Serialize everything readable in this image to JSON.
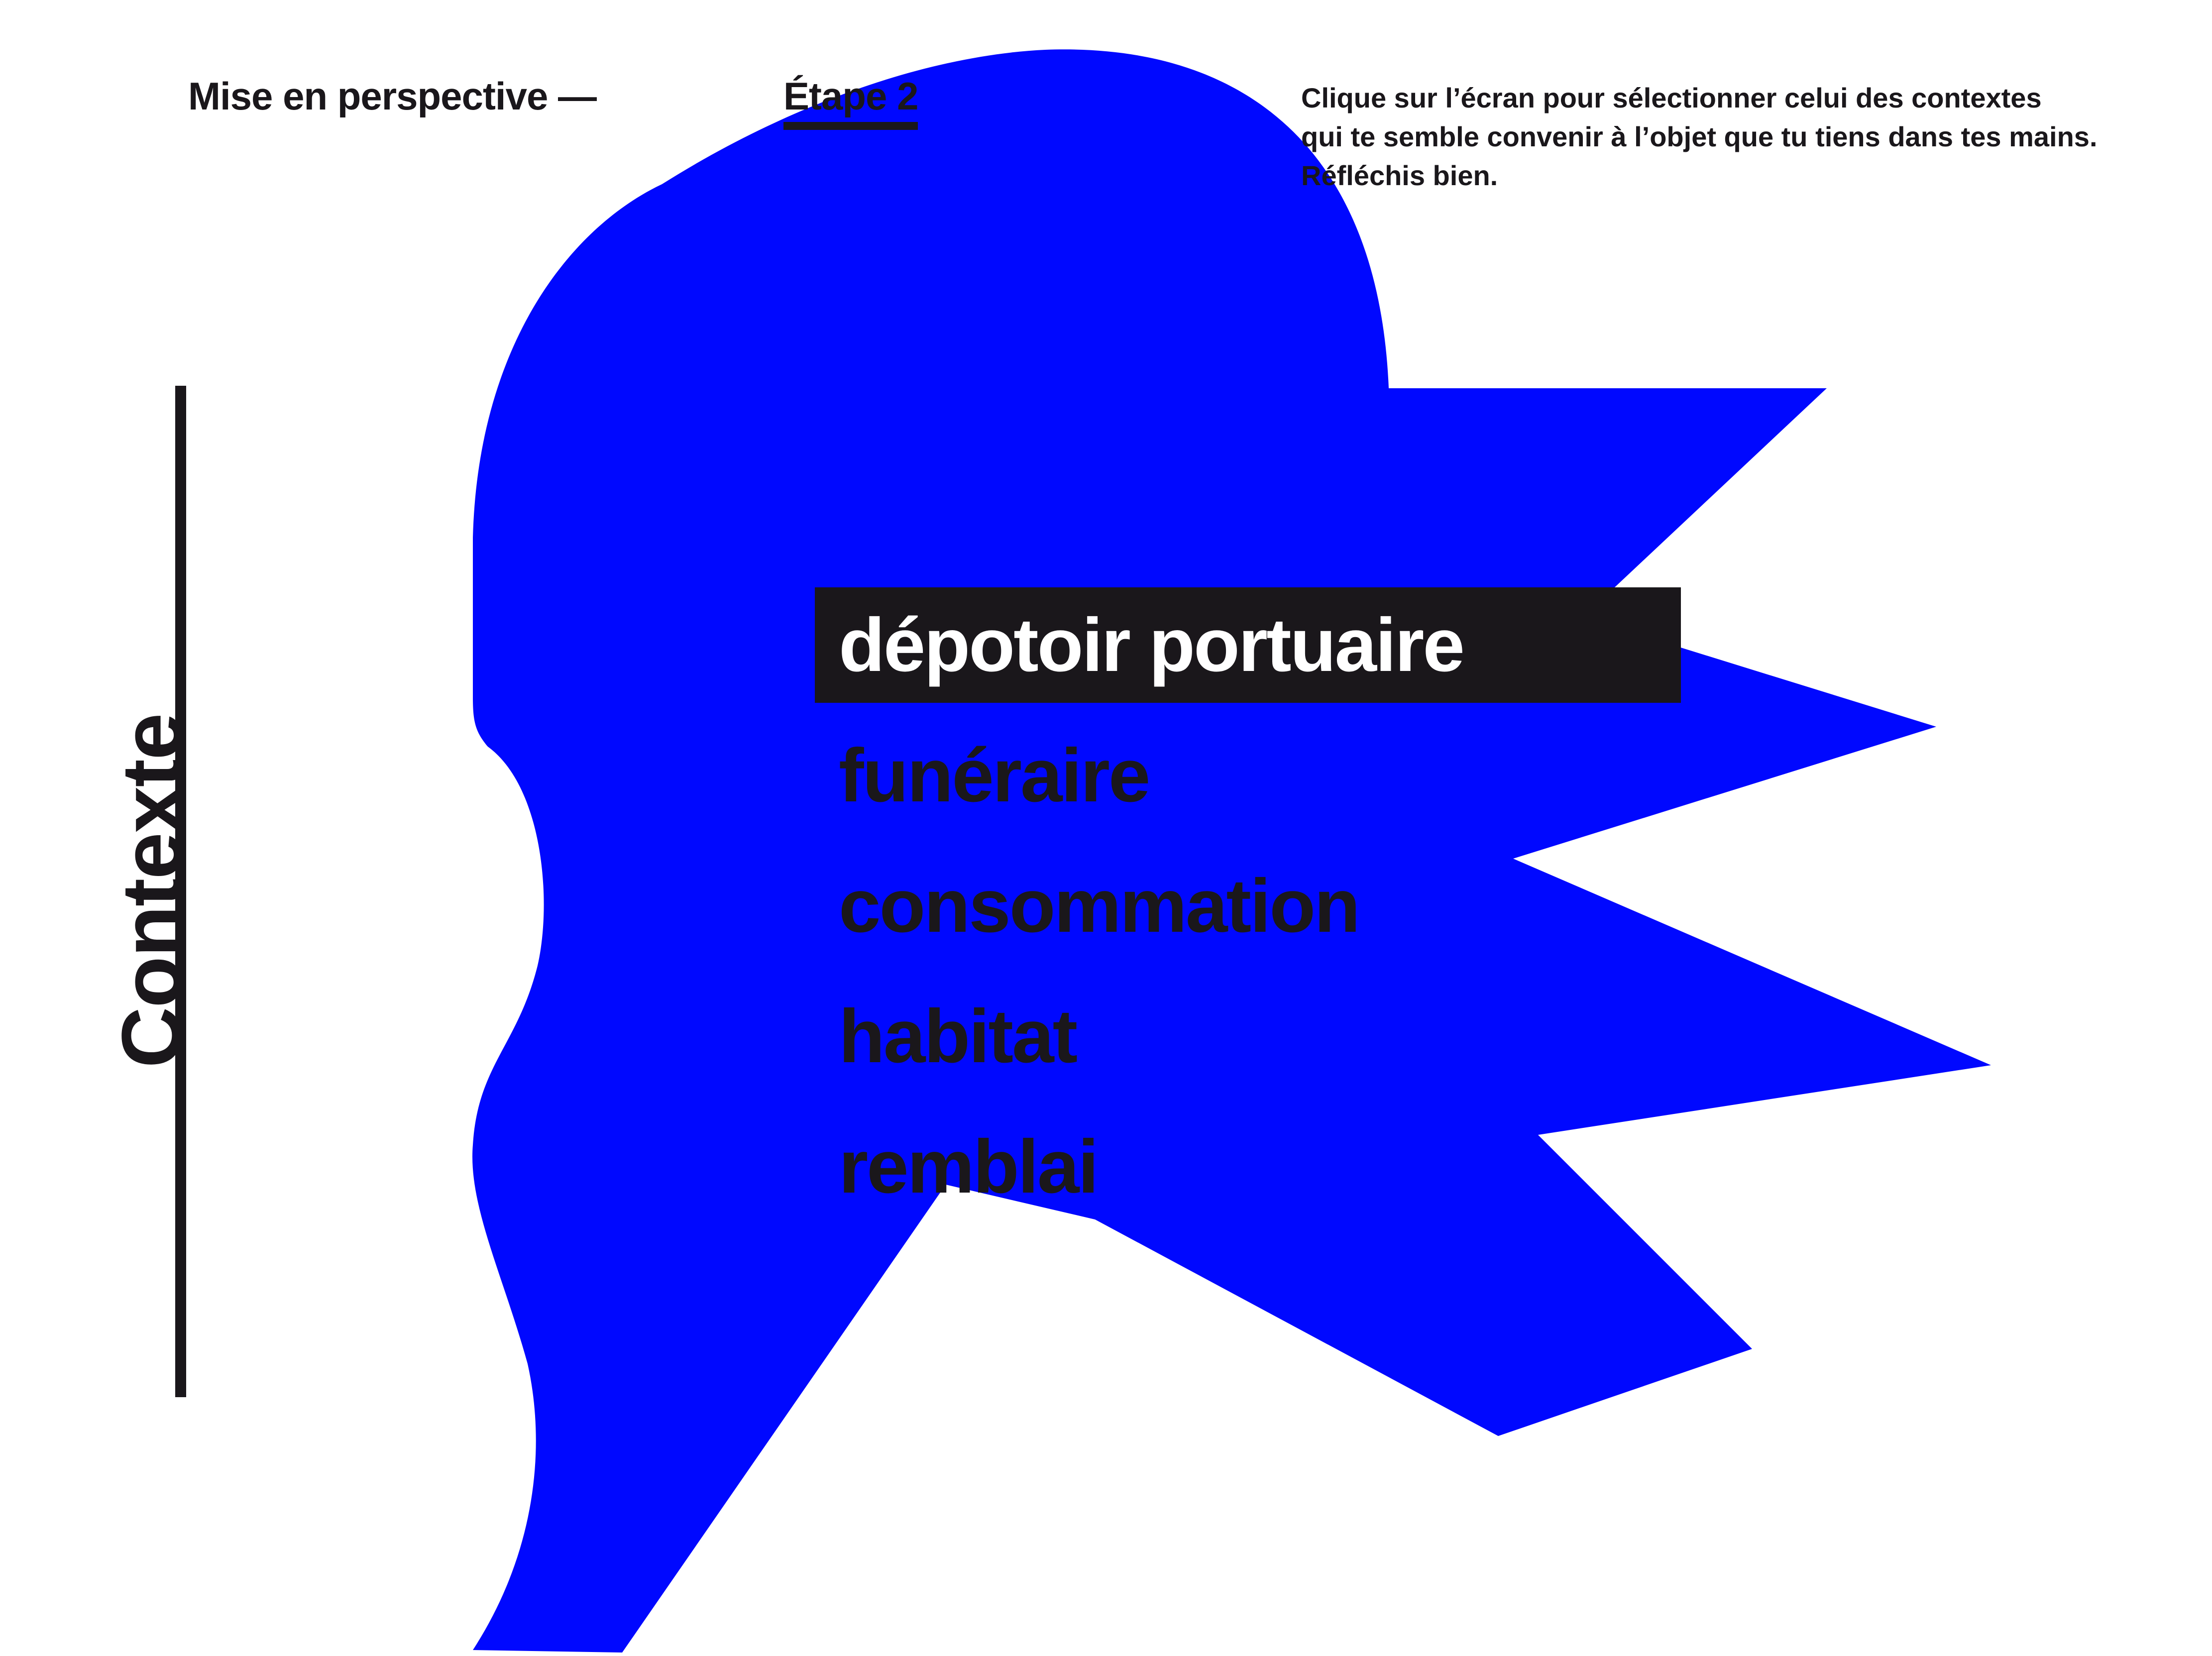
{
  "header": {
    "title": "Mise en perspective —",
    "step": "Étape 2"
  },
  "instructions": {
    "line1": "Clique sur l’écran pour sélectionner celui des contextes",
    "line2": "qui te semble convenir à l’objet que tu tiens dans tes mains.",
    "line3": "Réfléchis bien."
  },
  "sidebar": {
    "label": "Contexte"
  },
  "contexts": {
    "selected_index": 0,
    "items": [
      {
        "label": "dépotoir portuaire"
      },
      {
        "label": "funéraire"
      },
      {
        "label": "consommation"
      },
      {
        "label": "habitat"
      },
      {
        "label": "remblai"
      }
    ]
  },
  "colors": {
    "accent_blue": "#0008ff",
    "ink": "#1a171b",
    "background": "#ffffff"
  }
}
